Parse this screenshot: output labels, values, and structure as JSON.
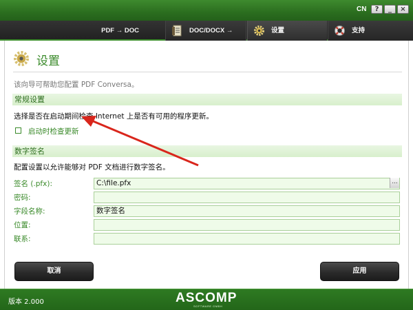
{
  "window": {
    "language": "CN",
    "help_label": "?",
    "minimize_label": "_",
    "close_label": "×"
  },
  "nav": {
    "tabs": [
      {
        "label": "PDF → DOC",
        "icon": "none"
      },
      {
        "label": "DOC/DOCX → PDF",
        "icon": "document-icon"
      },
      {
        "label": "设置",
        "icon": "gear-icon",
        "active": true
      },
      {
        "label": "支持",
        "icon": "lifebuoy-icon"
      }
    ]
  },
  "page": {
    "title": "设置",
    "description": "该向导可帮助您配置 PDF Conversa。"
  },
  "general": {
    "header": "常规设置",
    "text": "选择是否在启动期间检查 Internet 上是否有可用的程序更新。",
    "checkbox_label": "启动时检查更新",
    "checkbox_checked": false
  },
  "signature": {
    "header": "数字签名",
    "text": "配置设置以允许能够对 PDF 文档进行数字签名。",
    "fields": [
      {
        "label": "签名 (.pfx):",
        "value": "C:\\file.pfx"
      },
      {
        "label": "密码:",
        "value": ""
      },
      {
        "label": "字段名称:",
        "value": "数字签名"
      },
      {
        "label": "位置:",
        "value": ""
      },
      {
        "label": "联系:",
        "value": ""
      }
    ],
    "browse_label": "..."
  },
  "buttons": {
    "cancel": "取消",
    "apply": "应用"
  },
  "footer": {
    "version": "版本 2.000",
    "logo": "ASCOMP",
    "logo_sub": "SOFTWARE GMBH"
  },
  "colors": {
    "accent_green": "#3a8a2a",
    "annotation_arrow": "#d9261c"
  }
}
